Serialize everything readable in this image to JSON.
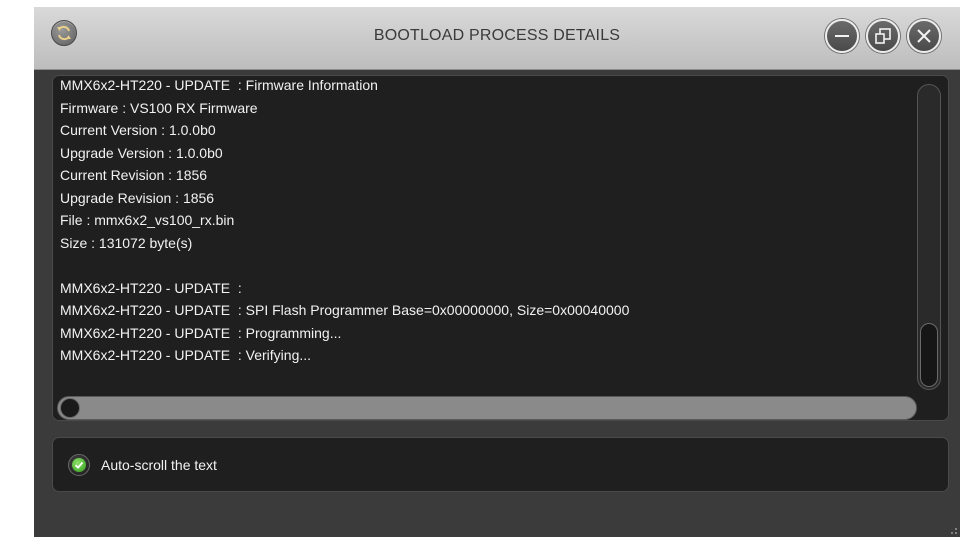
{
  "window": {
    "title": "BOOTLOAD PROCESS DETAILS",
    "icons": {
      "app": "refresh-icon",
      "minimize": "minimize-icon",
      "restore": "restore-icon",
      "close": "close-icon"
    }
  },
  "log": {
    "lines": [
      "MMX6x2-HT220 - UPDATE  : Firmware Information",
      "Firmware : VS100 RX Firmware",
      "Current Version : 1.0.0b0",
      "Upgrade Version : 1.0.0b0",
      "Current Revision : 1856",
      "Upgrade Revision : 1856",
      "File : mmx6x2_vs100_rx.bin",
      "Size : 131072 byte(s)",
      "",
      "MMX6x2-HT220 - UPDATE  :",
      "MMX6x2-HT220 - UPDATE  : SPI Flash Programmer Base=0x00000000, Size=0x00040000",
      "MMX6x2-HT220 - UPDATE  : Programming...",
      "MMX6x2-HT220 - UPDATE  : Verifying..."
    ]
  },
  "options": {
    "autoscroll_label": "Auto-scroll the text",
    "autoscroll_checked": true
  },
  "colors": {
    "accent_check": "#3fae22",
    "panel_bg": "#1f1f1f",
    "window_bg": "#3b3b3b"
  }
}
